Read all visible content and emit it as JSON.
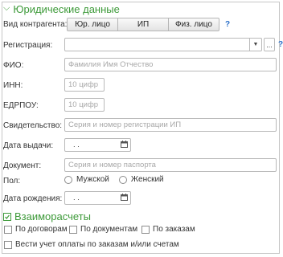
{
  "legal_section": {
    "title": "Юридические данные"
  },
  "contractor_type": {
    "label": "Вид контрагента:",
    "options": [
      "Юр. лицо",
      "ИП",
      "Физ. лицо"
    ],
    "help": "?"
  },
  "registration": {
    "label": "Регистрация:",
    "value": "",
    "help": "?",
    "more": "..."
  },
  "fio": {
    "label": "ФИО:",
    "placeholder": "Фамилия Имя Отчество"
  },
  "inn": {
    "label": "ИНН:",
    "placeholder": "10 цифр"
  },
  "edrpou": {
    "label": "ЕДРПОУ:",
    "placeholder": "10 цифр"
  },
  "certificate": {
    "label": "Свидетельство:",
    "placeholder": "Серия и номер регистрации ИП"
  },
  "issue_date": {
    "label": "Дата выдачи:",
    "value": ". ."
  },
  "document": {
    "label": "Документ:",
    "placeholder": "Серия и номер паспорта"
  },
  "gender": {
    "label": "Пол:",
    "options": [
      "Мужской",
      "Женский"
    ]
  },
  "birth_date": {
    "label": "Дата рождения:",
    "value": ". ."
  },
  "settlements": {
    "title": "Взаиморасчеты",
    "by_contracts": "По договорам",
    "by_documents": "По документам",
    "by_orders": "По заказам",
    "track_payment": "Вести учет оплаты по заказам и/или счетам"
  },
  "colors": {
    "accent": "#3d9a39",
    "help": "#2a6fc9"
  }
}
